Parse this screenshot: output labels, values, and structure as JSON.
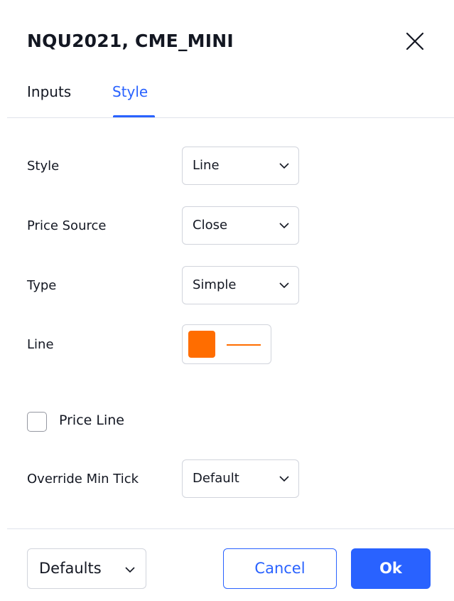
{
  "dialog": {
    "title": "NQU2021, CME_MINI"
  },
  "tabs": [
    {
      "label": "Inputs",
      "active": false
    },
    {
      "label": "Style",
      "active": true
    }
  ],
  "settings": {
    "style": {
      "label": "Style",
      "value": "Line"
    },
    "price_source": {
      "label": "Price Source",
      "value": "Close"
    },
    "type": {
      "label": "Type",
      "value": "Simple"
    },
    "line": {
      "label": "Line",
      "color": "#ff6d00"
    },
    "price_line": {
      "label": "Price Line",
      "checked": false
    },
    "override_min_tick": {
      "label": "Override Min Tick",
      "value": "Default"
    }
  },
  "footer": {
    "defaults_label": "Defaults",
    "cancel_label": "Cancel",
    "ok_label": "Ok"
  },
  "colors": {
    "accent": "#2962ff",
    "line_color": "#ff6d00",
    "border": "#d1d4dc",
    "text": "#131722"
  },
  "icons": {
    "close": "close-icon",
    "dropdown": "chevron-down-icon"
  }
}
